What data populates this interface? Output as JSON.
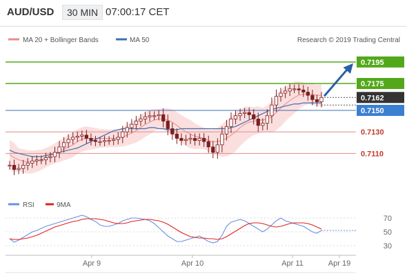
{
  "header": {
    "symbol": "AUD/USD",
    "timeframe": "30 MIN",
    "time": "07:00:17 CET"
  },
  "legend": {
    "bands_label": "MA 20 + Bollinger Bands",
    "ma50_label": "MA 50",
    "copyright": "Research © 2019 Trading Central",
    "rsi_label": "RSI",
    "ma9_label": "9MA"
  },
  "colors": {
    "bands_fill": "#fbdcdc",
    "bands_line": "#e98a8a",
    "ma50": "#3e6fb0",
    "candle": "#7a1f1f",
    "resistance_green": "#52a81a",
    "support_red": "#e28a8a",
    "target_arrow": "#2a5fa8",
    "rsi": "#6b8fe0",
    "rsi_ma": "#e02020",
    "current_bg": "#333333",
    "price_level_bg": "#3b7fd1"
  },
  "levels": {
    "target": "0.7195",
    "resistance2": "0.7175",
    "current": "0.7162",
    "pivot": "0.7150",
    "support1": "0.7130",
    "support2": "0.7110"
  },
  "chart_data": [
    {
      "type": "line",
      "panel": "price",
      "ylim": [
        0.7073,
        0.7209
      ],
      "x_labels": [
        "Apr 9",
        "Apr 10",
        "Apr 11",
        "Apr 19"
      ],
      "horizontal_levels": [
        0.7195,
        0.7175,
        0.7162,
        0.715,
        0.713,
        0.711
      ],
      "series": [
        {
          "name": "price",
          "values": [
            0.7099,
            0.7095,
            0.7096,
            0.7099,
            0.7101,
            0.7103,
            0.7104,
            0.7104,
            0.7106,
            0.7107,
            0.7111,
            0.7116,
            0.712,
            0.7123,
            0.7125,
            0.7126,
            0.7127,
            0.7124,
            0.7122,
            0.7121,
            0.7121,
            0.7122,
            0.7122,
            0.7123,
            0.7125,
            0.713,
            0.7134,
            0.7137,
            0.714,
            0.7142,
            0.7144,
            0.7145,
            0.7145,
            0.7146,
            0.714,
            0.7133,
            0.7128,
            0.7124,
            0.7122,
            0.7123,
            0.7124,
            0.7122,
            0.7124,
            0.7121,
            0.7116,
            0.7111,
            0.7118,
            0.7128,
            0.7135,
            0.7142,
            0.7145,
            0.7147,
            0.7148,
            0.7146,
            0.7142,
            0.7136,
            0.7138,
            0.7145,
            0.7155,
            0.7163,
            0.7166,
            0.7168,
            0.717,
            0.717,
            0.7169,
            0.7167,
            0.7164,
            0.716,
            0.7158,
            0.7162
          ]
        },
        {
          "name": "MA 20 + Bollinger Bands",
          "values": [
            0.7109,
            0.7106,
            0.7104,
            0.7103,
            0.7102,
            0.7102,
            0.7103,
            0.7104,
            0.7106,
            0.7108,
            0.711,
            0.7112,
            0.7114,
            0.7116,
            0.7118,
            0.7121,
            0.7123,
            0.7124,
            0.7124,
            0.7124,
            0.7124,
            0.7124,
            0.7124,
            0.7124,
            0.7124,
            0.7125,
            0.7127,
            0.7129,
            0.7131,
            0.7134,
            0.7137,
            0.7139,
            0.7141,
            0.7142,
            0.7142,
            0.7141,
            0.7139,
            0.7136,
            0.7133,
            0.713,
            0.7128,
            0.7126,
            0.7125,
            0.7124,
            0.7122,
            0.7121,
            0.7121,
            0.7122,
            0.7124,
            0.7127,
            0.713,
            0.7134,
            0.7137,
            0.7139,
            0.714,
            0.7141,
            0.7141,
            0.7142,
            0.7144,
            0.7148,
            0.7152,
            0.7156,
            0.7159,
            0.7162,
            0.7164,
            0.7165,
            0.7165,
            0.7165,
            0.7164,
            0.7164
          ]
        },
        {
          "name": "MA 50",
          "values": [
            0.7113,
            0.7111,
            0.711,
            0.7109,
            0.7108,
            0.7107,
            0.7107,
            0.7107,
            0.7108,
            0.7109,
            0.711,
            0.7111,
            0.7112,
            0.7113,
            0.7114,
            0.7115,
            0.7117,
            0.7119,
            0.7121,
            0.7123,
            0.7125,
            0.7127,
            0.7129,
            0.7131,
            0.7132,
            0.7133,
            0.7133,
            0.7133,
            0.7133,
            0.7133,
            0.7133,
            0.7134,
            0.7134,
            0.7133,
            0.7133,
            0.7132,
            0.7132,
            0.7132,
            0.7133,
            0.7133,
            0.7133,
            0.7133,
            0.7133,
            0.7133,
            0.7133,
            0.7133,
            0.7133,
            0.7133,
            0.7133,
            0.7134,
            0.7135,
            0.7137,
            0.7139,
            0.7141,
            0.7143,
            0.7145,
            0.7147,
            0.7149,
            0.7151,
            0.7152,
            0.7153,
            0.7154,
            0.7155,
            0.7156,
            0.7156,
            0.7157,
            0.7157,
            0.7157,
            0.7157,
            0.7157
          ]
        }
      ]
    },
    {
      "type": "line",
      "panel": "rsi",
      "ylim": [
        20,
        80
      ],
      "yticks": [
        70,
        50,
        30
      ],
      "series": [
        {
          "name": "RSI",
          "values": [
            40,
            35,
            38,
            42,
            46,
            50,
            52,
            55,
            58,
            60,
            62,
            64,
            66,
            68,
            70,
            72,
            74,
            72,
            68,
            65,
            60,
            58,
            58,
            60,
            62,
            66,
            68,
            70,
            70,
            69,
            68,
            66,
            62,
            56,
            50,
            44,
            40,
            36,
            36,
            38,
            40,
            42,
            44,
            40,
            36,
            34,
            36,
            45,
            58,
            64,
            66,
            68,
            66,
            62,
            58,
            54,
            50,
            54,
            60,
            66,
            70,
            66,
            64,
            62,
            60,
            58,
            54,
            50,
            48,
            52
          ]
        },
        {
          "name": "9MA",
          "values": [
            40,
            39,
            39,
            40,
            41,
            43,
            45,
            48,
            51,
            54,
            57,
            59,
            61,
            63,
            65,
            66,
            68,
            69,
            69,
            69,
            68,
            67,
            65,
            63,
            62,
            62,
            63,
            65,
            66,
            67,
            68,
            68,
            67,
            66,
            64,
            61,
            57,
            53,
            49,
            46,
            43,
            42,
            41,
            41,
            40,
            40,
            39,
            40,
            43,
            47,
            51,
            55,
            59,
            62,
            63,
            63,
            62,
            60,
            58,
            57,
            58,
            60,
            62,
            63,
            63,
            63,
            62,
            60,
            57,
            54
          ]
        }
      ]
    }
  ]
}
